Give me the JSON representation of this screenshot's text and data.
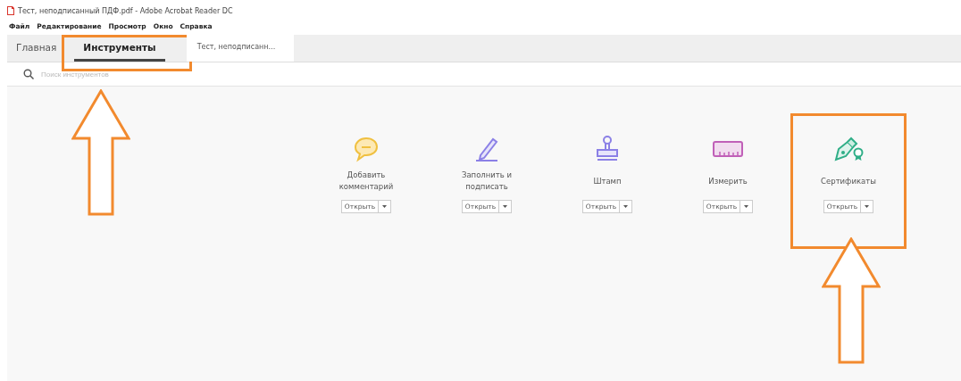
{
  "window": {
    "title": "Тест, неподписанный ПДФ.pdf - Adobe Acrobat Reader DC"
  },
  "menu": [
    "Файл",
    "Редактирование",
    "Просмотр",
    "Окно",
    "Справка"
  ],
  "tabs": [
    {
      "label": "Главная",
      "selected": false,
      "kind": "nav",
      "highlighted": false
    },
    {
      "label": "Инструменты",
      "selected": true,
      "kind": "nav",
      "highlighted": true
    },
    {
      "label": "Тест, неподписанн...",
      "selected": false,
      "kind": "document",
      "highlighted": false
    }
  ],
  "search": {
    "placeholder": "Поиск инструментов"
  },
  "tools": [
    {
      "kind": "comment",
      "label": "Добавить комментарий",
      "button": "Открыть",
      "highlighted": false
    },
    {
      "kind": "sign",
      "label": "Заполнить и подписать",
      "button": "Открыть",
      "highlighted": false
    },
    {
      "kind": "stamp",
      "label": "Штамп",
      "button": "Открыть",
      "highlighted": false
    },
    {
      "kind": "measure",
      "label": "Измерить",
      "button": "Открыть",
      "highlighted": false
    },
    {
      "kind": "certificate",
      "label": "Сертификаты",
      "button": "Открыть",
      "highlighted": true
    }
  ],
  "annotations": [
    {
      "kind": "arrow"
    },
    {
      "kind": "arrow"
    }
  ]
}
